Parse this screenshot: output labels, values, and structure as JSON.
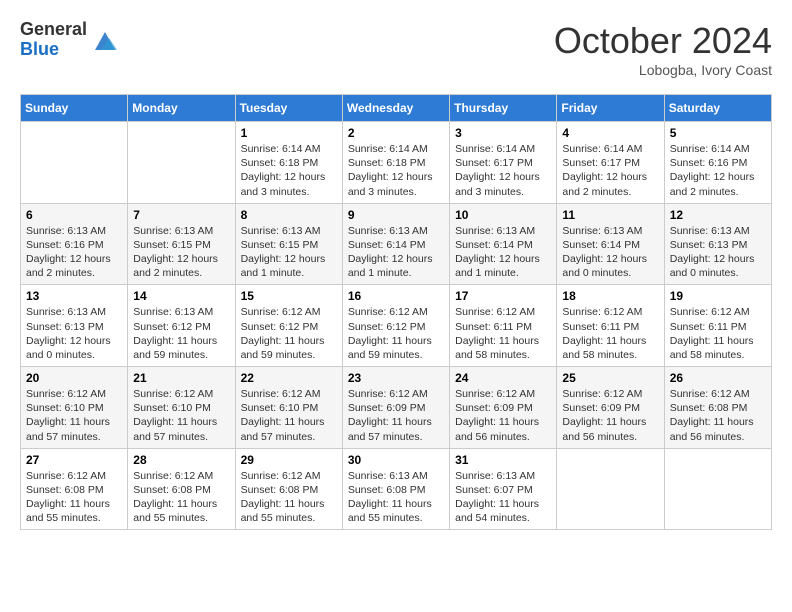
{
  "header": {
    "logo_general": "General",
    "logo_blue": "Blue",
    "month_title": "October 2024",
    "subtitle": "Lobogba, Ivory Coast"
  },
  "weekdays": [
    "Sunday",
    "Monday",
    "Tuesday",
    "Wednesday",
    "Thursday",
    "Friday",
    "Saturday"
  ],
  "weeks": [
    [
      {
        "day": "",
        "info": ""
      },
      {
        "day": "",
        "info": ""
      },
      {
        "day": "1",
        "info": "Sunrise: 6:14 AM\nSunset: 6:18 PM\nDaylight: 12 hours and 3 minutes."
      },
      {
        "day": "2",
        "info": "Sunrise: 6:14 AM\nSunset: 6:18 PM\nDaylight: 12 hours and 3 minutes."
      },
      {
        "day": "3",
        "info": "Sunrise: 6:14 AM\nSunset: 6:17 PM\nDaylight: 12 hours and 3 minutes."
      },
      {
        "day": "4",
        "info": "Sunrise: 6:14 AM\nSunset: 6:17 PM\nDaylight: 12 hours and 2 minutes."
      },
      {
        "day": "5",
        "info": "Sunrise: 6:14 AM\nSunset: 6:16 PM\nDaylight: 12 hours and 2 minutes."
      }
    ],
    [
      {
        "day": "6",
        "info": "Sunrise: 6:13 AM\nSunset: 6:16 PM\nDaylight: 12 hours and 2 minutes."
      },
      {
        "day": "7",
        "info": "Sunrise: 6:13 AM\nSunset: 6:15 PM\nDaylight: 12 hours and 2 minutes."
      },
      {
        "day": "8",
        "info": "Sunrise: 6:13 AM\nSunset: 6:15 PM\nDaylight: 12 hours and 1 minute."
      },
      {
        "day": "9",
        "info": "Sunrise: 6:13 AM\nSunset: 6:14 PM\nDaylight: 12 hours and 1 minute."
      },
      {
        "day": "10",
        "info": "Sunrise: 6:13 AM\nSunset: 6:14 PM\nDaylight: 12 hours and 1 minute."
      },
      {
        "day": "11",
        "info": "Sunrise: 6:13 AM\nSunset: 6:14 PM\nDaylight: 12 hours and 0 minutes."
      },
      {
        "day": "12",
        "info": "Sunrise: 6:13 AM\nSunset: 6:13 PM\nDaylight: 12 hours and 0 minutes."
      }
    ],
    [
      {
        "day": "13",
        "info": "Sunrise: 6:13 AM\nSunset: 6:13 PM\nDaylight: 12 hours and 0 minutes."
      },
      {
        "day": "14",
        "info": "Sunrise: 6:13 AM\nSunset: 6:12 PM\nDaylight: 11 hours and 59 minutes."
      },
      {
        "day": "15",
        "info": "Sunrise: 6:12 AM\nSunset: 6:12 PM\nDaylight: 11 hours and 59 minutes."
      },
      {
        "day": "16",
        "info": "Sunrise: 6:12 AM\nSunset: 6:12 PM\nDaylight: 11 hours and 59 minutes."
      },
      {
        "day": "17",
        "info": "Sunrise: 6:12 AM\nSunset: 6:11 PM\nDaylight: 11 hours and 58 minutes."
      },
      {
        "day": "18",
        "info": "Sunrise: 6:12 AM\nSunset: 6:11 PM\nDaylight: 11 hours and 58 minutes."
      },
      {
        "day": "19",
        "info": "Sunrise: 6:12 AM\nSunset: 6:11 PM\nDaylight: 11 hours and 58 minutes."
      }
    ],
    [
      {
        "day": "20",
        "info": "Sunrise: 6:12 AM\nSunset: 6:10 PM\nDaylight: 11 hours and 57 minutes."
      },
      {
        "day": "21",
        "info": "Sunrise: 6:12 AM\nSunset: 6:10 PM\nDaylight: 11 hours and 57 minutes."
      },
      {
        "day": "22",
        "info": "Sunrise: 6:12 AM\nSunset: 6:10 PM\nDaylight: 11 hours and 57 minutes."
      },
      {
        "day": "23",
        "info": "Sunrise: 6:12 AM\nSunset: 6:09 PM\nDaylight: 11 hours and 57 minutes."
      },
      {
        "day": "24",
        "info": "Sunrise: 6:12 AM\nSunset: 6:09 PM\nDaylight: 11 hours and 56 minutes."
      },
      {
        "day": "25",
        "info": "Sunrise: 6:12 AM\nSunset: 6:09 PM\nDaylight: 11 hours and 56 minutes."
      },
      {
        "day": "26",
        "info": "Sunrise: 6:12 AM\nSunset: 6:08 PM\nDaylight: 11 hours and 56 minutes."
      }
    ],
    [
      {
        "day": "27",
        "info": "Sunrise: 6:12 AM\nSunset: 6:08 PM\nDaylight: 11 hours and 55 minutes."
      },
      {
        "day": "28",
        "info": "Sunrise: 6:12 AM\nSunset: 6:08 PM\nDaylight: 11 hours and 55 minutes."
      },
      {
        "day": "29",
        "info": "Sunrise: 6:12 AM\nSunset: 6:08 PM\nDaylight: 11 hours and 55 minutes."
      },
      {
        "day": "30",
        "info": "Sunrise: 6:13 AM\nSunset: 6:08 PM\nDaylight: 11 hours and 55 minutes."
      },
      {
        "day": "31",
        "info": "Sunrise: 6:13 AM\nSunset: 6:07 PM\nDaylight: 11 hours and 54 minutes."
      },
      {
        "day": "",
        "info": ""
      },
      {
        "day": "",
        "info": ""
      }
    ]
  ],
  "row_styles": [
    "normal",
    "alt",
    "normal",
    "alt",
    "normal"
  ]
}
